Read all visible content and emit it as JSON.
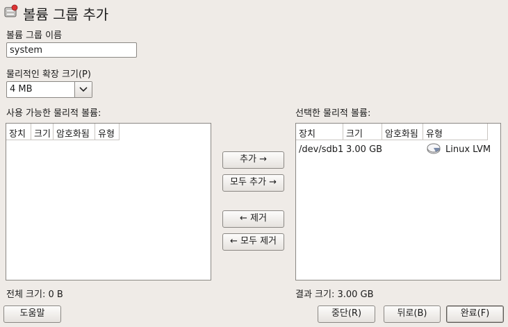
{
  "window": {
    "title": "볼륨 그룹 추가"
  },
  "form": {
    "vg_name_label": "볼륨 그룹 이름",
    "vg_name_value": "system",
    "extent_label": "물리적인 확장 크기(P)",
    "extent_value": "4 MB"
  },
  "available": {
    "label": "사용 가능한 물리적 볼륨:",
    "columns": [
      "장치",
      "크기",
      "암호화됨",
      "유형"
    ],
    "total_label": "전체 크기: 0 B"
  },
  "selected": {
    "label": "선택한 물리적 볼륨:",
    "columns": [
      "장치",
      "크기",
      "암호화됨",
      "유형"
    ],
    "rows": [
      {
        "device": "/dev/sdb1",
        "size": "3.00 GB",
        "encrypted": "",
        "type": "Linux LVM",
        "type_icon": "disk-icon"
      }
    ],
    "result_label": "결과 크기: 3.00 GB"
  },
  "transfer": {
    "add": "추가 →",
    "add_all": "모두 추가 →",
    "remove": "← 제거",
    "remove_all": "← 모두 제거"
  },
  "footer": {
    "help": "도움말",
    "abort": "중단(R)",
    "back": "뒤로(B)",
    "finish": "완료(F)"
  }
}
